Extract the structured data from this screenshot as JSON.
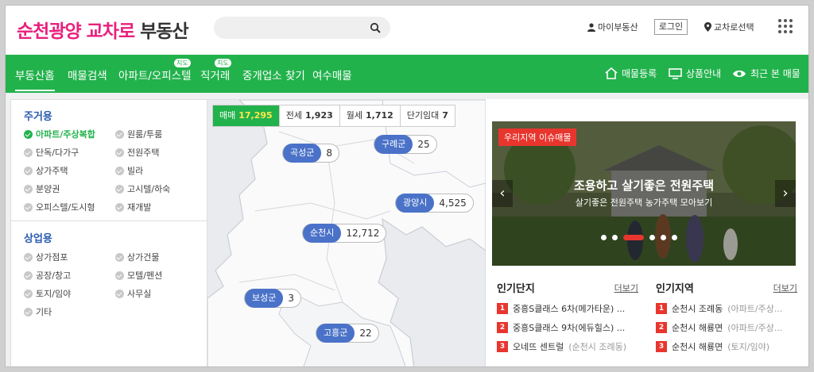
{
  "header": {
    "logo_main": "순천광양 교차로",
    "logo_sub": "부동산",
    "my_realestate": "마이부동산",
    "login": "로그인",
    "region_select": "교차로선택"
  },
  "nav": {
    "items": [
      "부동산홈",
      "매물검색",
      "아파트/오피스텔",
      "직거래",
      "중개업소 찾기",
      "여수매물"
    ],
    "badge": "지도",
    "right": [
      "매물등록",
      "상품안내",
      "최근 본 매물"
    ]
  },
  "residential": {
    "title": "주거용",
    "options": [
      "아파트/주상복합",
      "원룸/투룸",
      "단독/다가구",
      "전원주택",
      "상가주택",
      "빌라",
      "분양권",
      "고시텔/하숙",
      "오피스텔/도시형",
      "재개발"
    ],
    "selected": "아파트/주상복합"
  },
  "commercial": {
    "title": "상업용",
    "options": [
      "상가점포",
      "상가건물",
      "공장/창고",
      "모텔/펜션",
      "토지/임야",
      "사무실",
      "기타"
    ]
  },
  "map": {
    "tabs": [
      {
        "label": "매매",
        "count": "17,295"
      },
      {
        "label": "전세",
        "count": "1,923"
      },
      {
        "label": "월세",
        "count": "1,712"
      },
      {
        "label": "단기임대",
        "count": "7"
      }
    ],
    "markers": [
      {
        "name": "곡성군",
        "value": "8"
      },
      {
        "name": "구례군",
        "value": "25"
      },
      {
        "name": "광양시",
        "value": "4,525"
      },
      {
        "name": "순천시",
        "value": "12,712"
      },
      {
        "name": "보성군",
        "value": "3"
      },
      {
        "name": "고흥군",
        "value": "22"
      }
    ]
  },
  "banner": {
    "tag": "우리지역 이슈매물",
    "title": "조용하고 살기좋은 전원주택",
    "subtitle": "살기좋은 전원주택 농가주택 모아보기",
    "slide_count": 6,
    "active_slide": 3
  },
  "popular_complex": {
    "title": "인기단지",
    "more": "더보기",
    "items": [
      {
        "rank": "1",
        "name": "중흥S클래스 6차(메가타운) ...",
        "sub": ""
      },
      {
        "rank": "2",
        "name": "중흥S클래스 9차(에듀힐스) ...",
        "sub": ""
      },
      {
        "rank": "3",
        "name": "오네뜨 센트럴",
        "sub": "(순천시 조례동)"
      }
    ]
  },
  "popular_region": {
    "title": "인기지역",
    "more": "더보기",
    "items": [
      {
        "rank": "1",
        "name": "순천시 조례동",
        "sub": "(아파트/주상..."
      },
      {
        "rank": "2",
        "name": "순천시 해룡면",
        "sub": "(아파트/주상..."
      },
      {
        "rank": "3",
        "name": "순천시 해룡면",
        "sub": "(토지/임야)"
      }
    ]
  },
  "colors": {
    "brand_pink": "#e8207d",
    "nav_green": "#22b24c",
    "marker_blue": "#4a72c8",
    "accent_red": "#e8352e"
  }
}
